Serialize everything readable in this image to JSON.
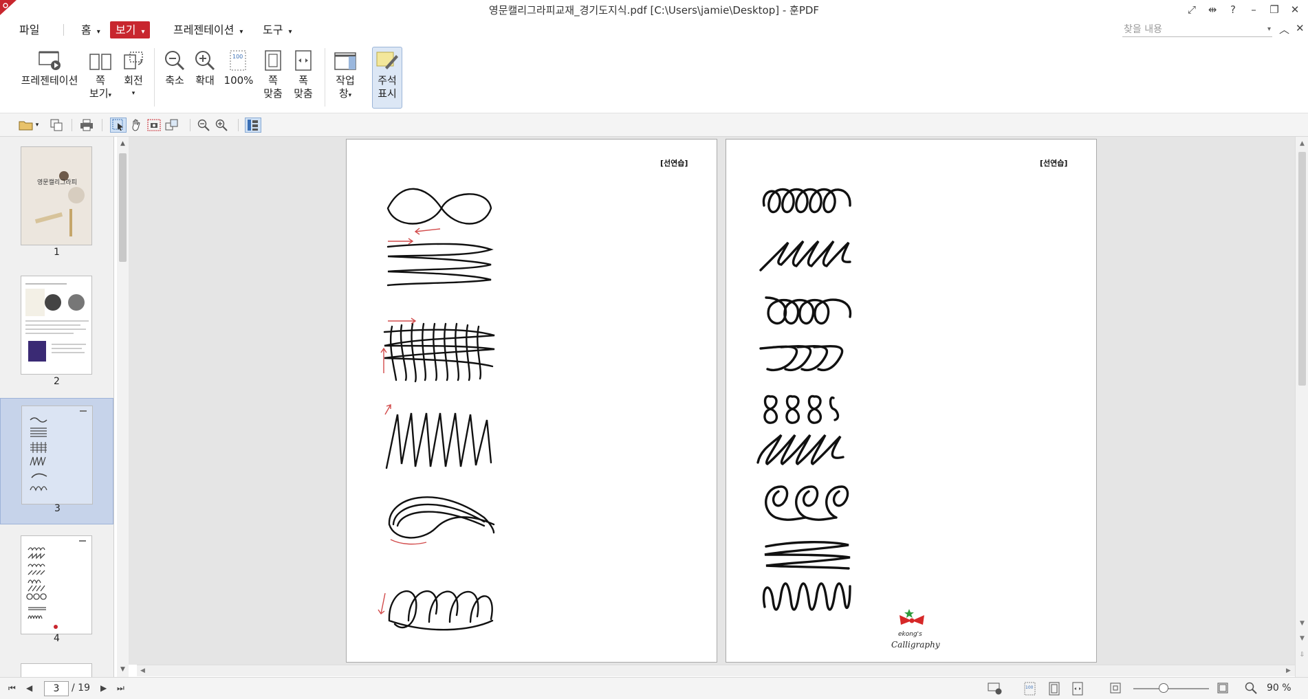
{
  "window": {
    "title": "영문캘리그라피교재_경기도지식.pdf [C:\\Users\\jamie\\Desktop] - 훈PDF",
    "accent_color": "#c8262e"
  },
  "menu": {
    "file": "파일",
    "home": "홈",
    "view": "보기",
    "presentation": "프레젠테이션",
    "tools": "도구",
    "search_placeholder": "찾을 내용"
  },
  "ribbon": {
    "presentation": "프레젠테이션",
    "page_view_1": "쪽",
    "page_view_2": "보기",
    "rotate": "회전",
    "zoom_out": "축소",
    "zoom_in": "확대",
    "zoom_100": "100%",
    "fit_page_1": "쪽",
    "fit_page_2": "맞춤",
    "fit_width_1": "폭",
    "fit_width_2": "맞춤",
    "work_pane_1": "작업",
    "work_pane_2": "창",
    "annotations_1": "주석",
    "annotations_2": "표시"
  },
  "thumbnails": [
    {
      "num": "1",
      "cover_title": "영문캘리그라피"
    },
    {
      "num": "2"
    },
    {
      "num": "3"
    },
    {
      "num": "4"
    }
  ],
  "pages": {
    "left_label": "[선연습]",
    "right_label": "[선연습]",
    "logo_line1": "ekong's",
    "logo_line2": "Calligraphy"
  },
  "status": {
    "current_page": "3",
    "total_pages": "/ 19",
    "zoom": "90 %",
    "zoom_fraction": 0.4
  }
}
